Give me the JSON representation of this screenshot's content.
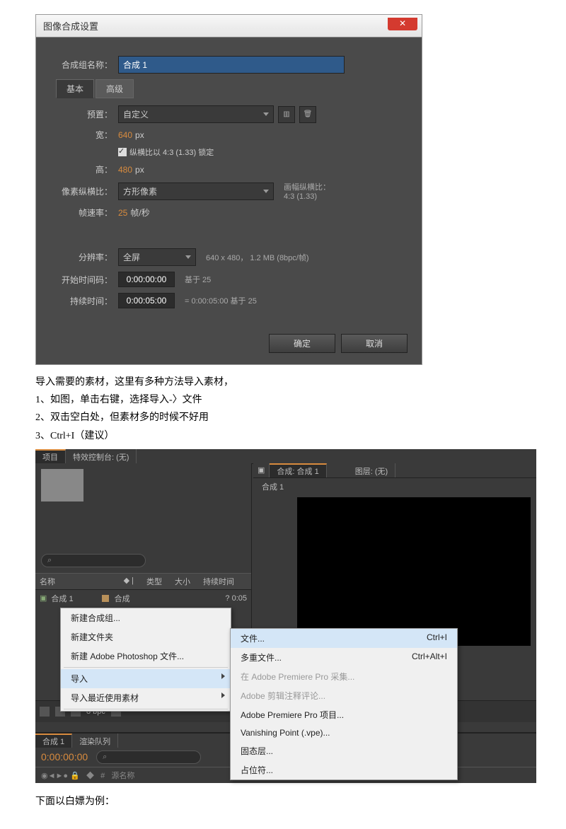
{
  "dialog": {
    "title": "图像合成设置",
    "compNameLabel": "合成组名称：",
    "compName": "合成 1",
    "tabBasic": "基本",
    "tabAdvanced": "高级",
    "presetLabel": "预置：",
    "presetValue": "自定义",
    "widthLabel": "宽：",
    "widthValue": "640",
    "widthUnit": "px",
    "heightLabel": "高：",
    "heightValue": "480",
    "heightUnit": "px",
    "lockAspect": "纵横比以 4:3 (1.33) 锁定",
    "parLabel": "像素纵横比：",
    "parValue": "方形像素",
    "frameAspectLabel": "画幅纵横比：",
    "frameAspectValue": "4:3 (1.33)",
    "frameRateLabel": "帧速率：",
    "frameRateValue": "25",
    "frameRateUnit": "帧/秒",
    "resolutionLabel": "分辨率：",
    "resolutionValue": "全屏",
    "resolutionInfo": "640 x 480， 1.2 MB (8bpc/帧)",
    "startTCLabel": "开始时间码：",
    "startTCValue": "0:00:00:00",
    "startTCBase": "基于 25",
    "durationLabel": "持续时间：",
    "durationValue": "0:00:05:00",
    "durationInfo": "= 0:00:05:00  基于 25",
    "ok": "确定",
    "cancel": "取消"
  },
  "text": {
    "p1": "导入需要的素材，这里有多种方法导入素材，",
    "p2": "1、如图，单击右键，选择导入-〉文件",
    "p3": "2、双击空白处，但素材多的时候不好用",
    "p4": "3、Ctrl+I（建议）",
    "p5": "下面以白嫖为例："
  },
  "ae": {
    "panelProject": "项目",
    "panelEffects": "特效控制台: (无)",
    "panelComp": "合成: 合成 1",
    "panelLayer": "图层: (无)",
    "compTab": "合成 1",
    "colName": "名称",
    "colType": "类型",
    "colSize": "大小",
    "colDuration": "持续时间",
    "itemName": "合成 1",
    "itemType": "合成",
    "itemDur": "? 0:05",
    "bpc": "8 bpc",
    "menu": {
      "newComp": "新建合成组...",
      "newFolder": "新建文件夹",
      "newPS": "新建 Adobe Photoshop 文件...",
      "import": "导入",
      "importRecent": "导入最近使用素材"
    },
    "submenu": {
      "file": "文件...",
      "fileShortcut": "Ctrl+I",
      "multiFile": "多重文件...",
      "multiFileShortcut": "Ctrl+Alt+I",
      "capture": "在 Adobe Premiere Pro 采集...",
      "anno": "Adobe 剪辑注释评论...",
      "prproj": "Adobe Premiere Pro 项目...",
      "vpe": "Vanishing Point (.vpe)...",
      "solid": "固态层...",
      "placeholder": "占位符..."
    },
    "timeline": {
      "tab1": "合成 1",
      "tab2": "渲染队列",
      "tc": "0:00:00:00",
      "src": "源名称"
    }
  }
}
